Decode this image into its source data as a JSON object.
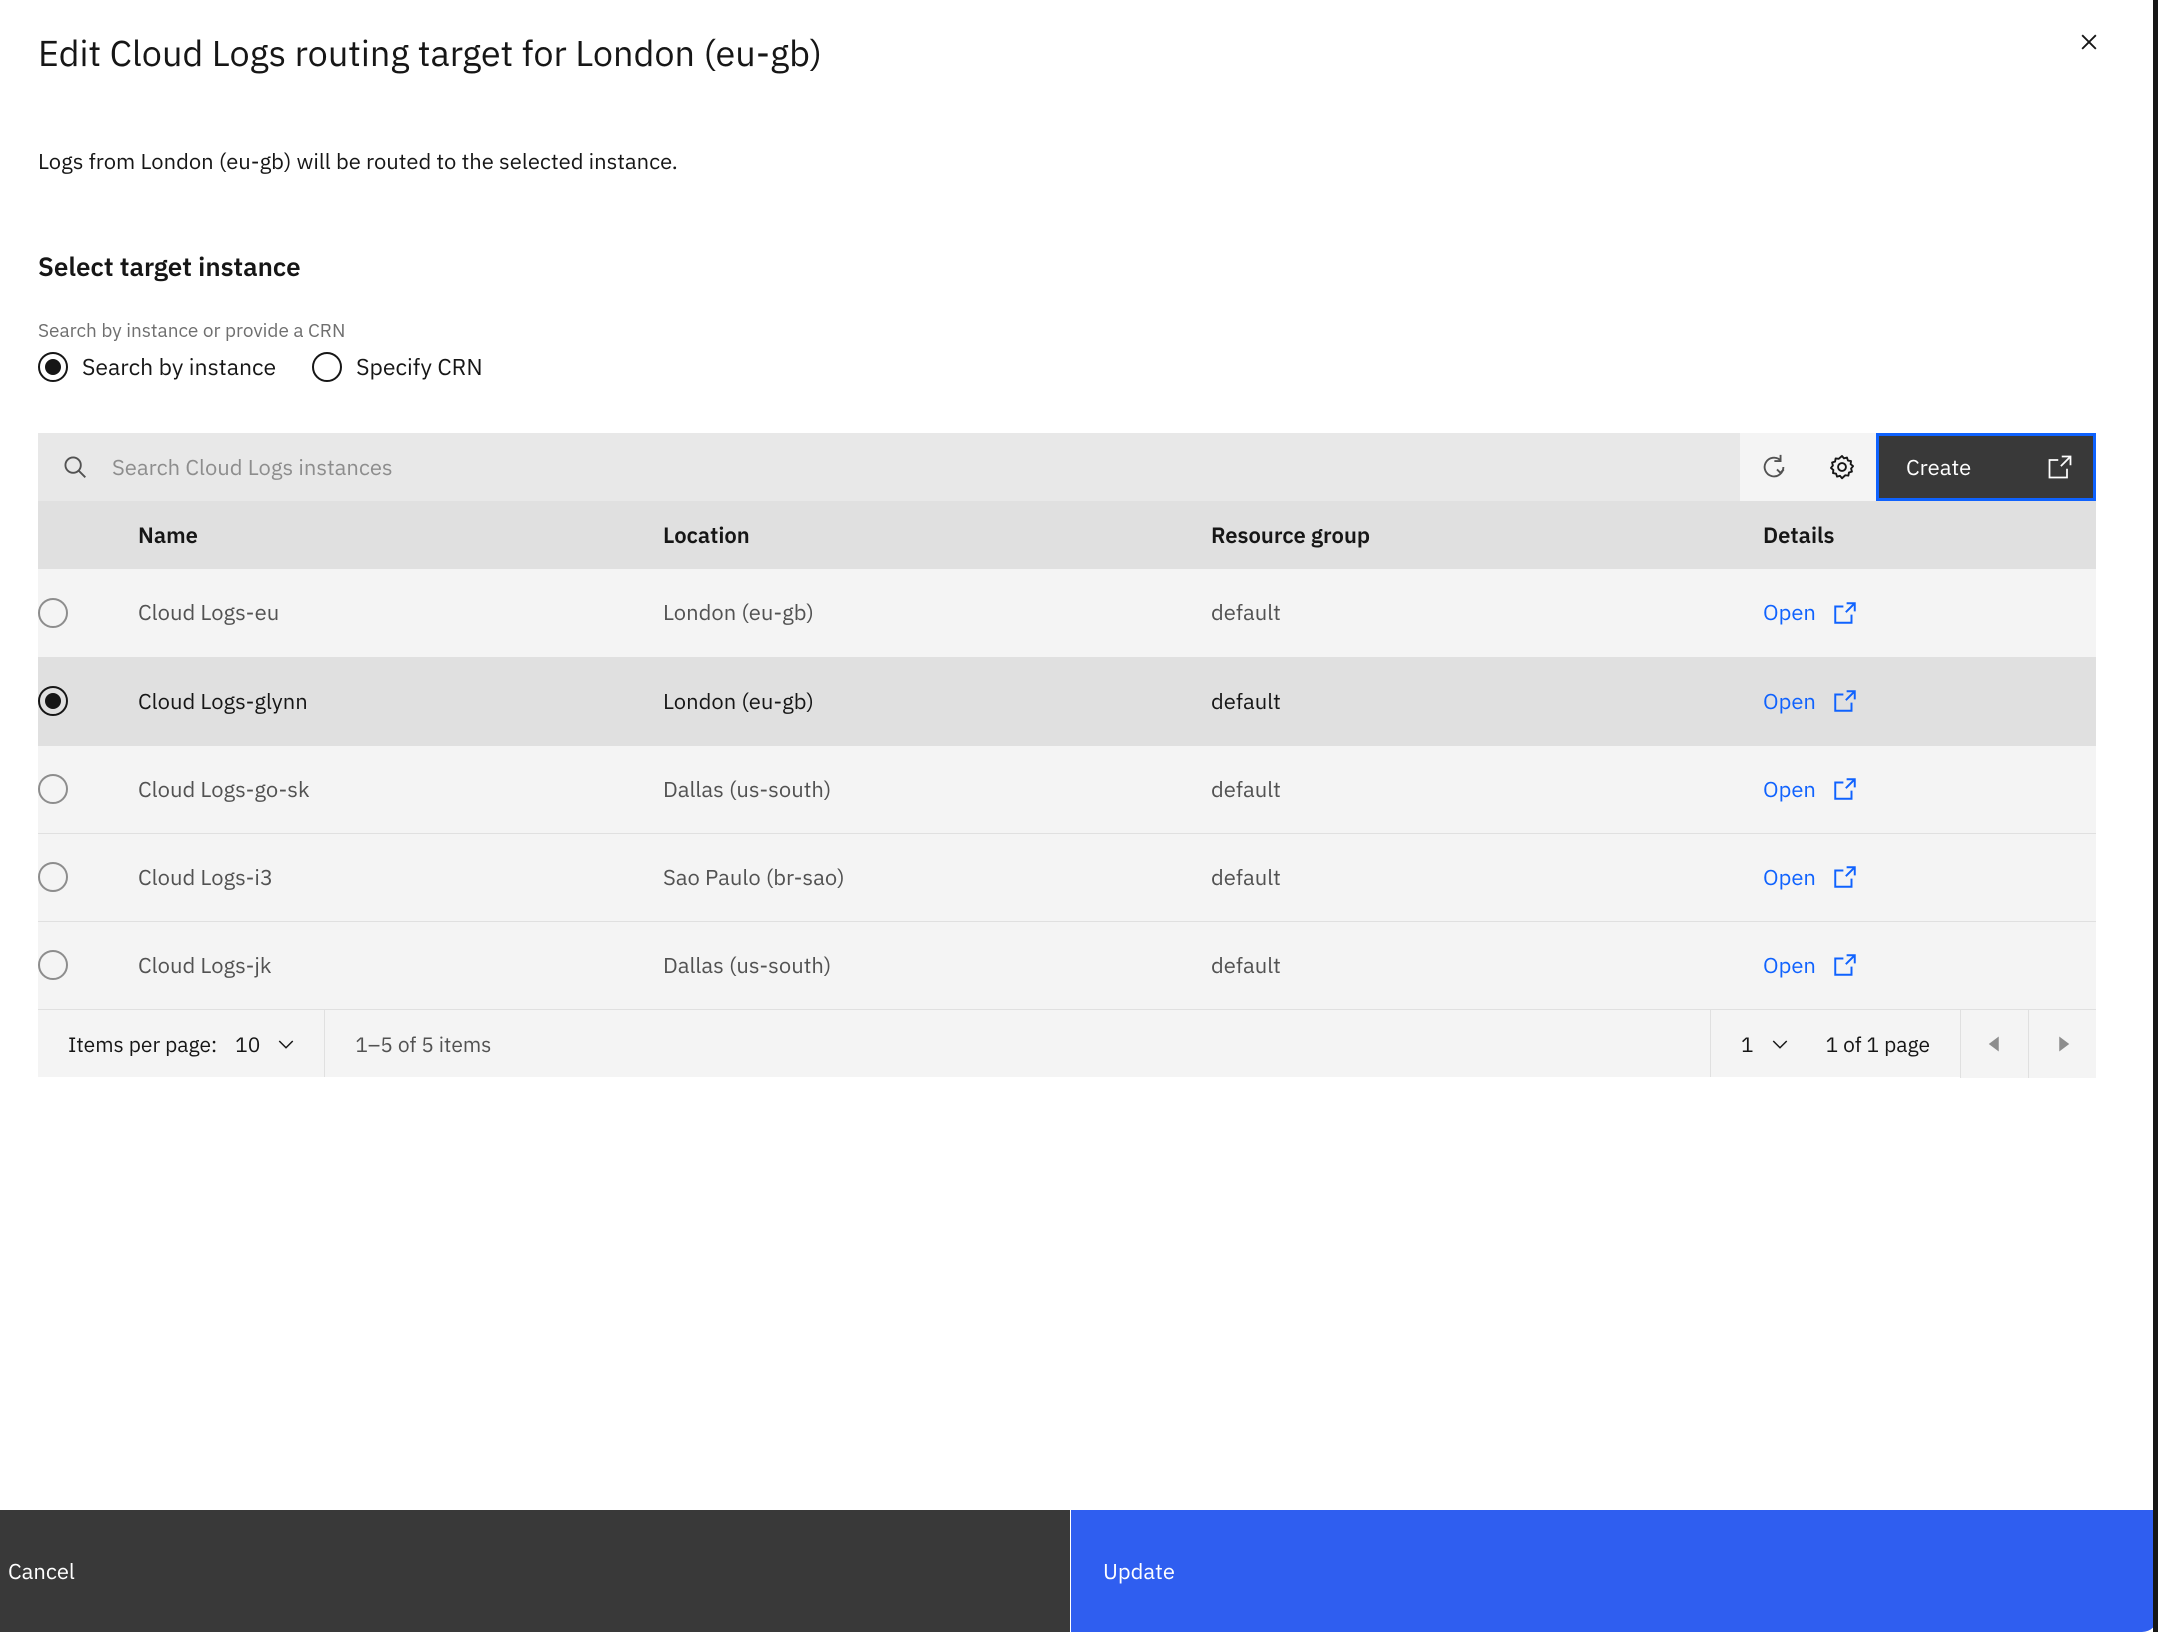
{
  "panel": {
    "title": "Edit Cloud Logs routing target for London (eu-gb)",
    "close_icon": "close-icon",
    "intro": "Logs from London (eu-gb) will be routed to the selected instance.",
    "section_heading": "Select target instance",
    "radio_legend": "Search by instance or provide a CRN"
  },
  "mode_radios": {
    "options": [
      {
        "label": "Search by instance",
        "selected": true
      },
      {
        "label": "Specify CRN",
        "selected": false
      }
    ]
  },
  "toolbar": {
    "search_placeholder": "Search Cloud Logs instances",
    "search_value": "",
    "search_icon": "search-icon",
    "refresh_icon": "refresh-icon",
    "settings_icon": "gear-icon",
    "create_label": "Create",
    "create_icon": "external-link-icon",
    "create_focused": true
  },
  "table": {
    "columns": [
      "",
      "Name",
      "Location",
      "Resource group",
      "Details"
    ],
    "rows": [
      {
        "name": "Cloud Logs-eu",
        "location": "London (eu-gb)",
        "resource_group": "default",
        "details_label": "Open",
        "details_icon": "external-link-icon",
        "selected": false
      },
      {
        "name": "Cloud Logs-glynn",
        "location": "London (eu-gb)",
        "resource_group": "default",
        "details_label": "Open",
        "details_icon": "external-link-icon",
        "selected": true
      },
      {
        "name": "Cloud Logs-go-sk",
        "location": "Dallas (us-south)",
        "resource_group": "default",
        "details_label": "Open",
        "details_icon": "external-link-icon",
        "selected": false
      },
      {
        "name": "Cloud Logs-i3",
        "location": "Sao Paulo (br-sao)",
        "resource_group": "default",
        "details_label": "Open",
        "details_icon": "external-link-icon",
        "selected": false
      },
      {
        "name": "Cloud Logs-jk",
        "location": "Dallas (us-south)",
        "resource_group": "default",
        "details_label": "Open",
        "details_icon": "external-link-icon",
        "selected": false
      }
    ]
  },
  "pagination": {
    "items_per_page_label": "Items per page:",
    "items_per_page_value": "10",
    "range_text": "1–5 of 5 items",
    "page_value": "1",
    "page_total_text": "1 of 1 page",
    "prev_icon": "caret-left-icon",
    "next_icon": "caret-right-icon"
  },
  "actions": {
    "cancel_label": "Cancel",
    "update_label": "Update"
  },
  "colors": {
    "accent_blue": "#0f62fe",
    "primary_button": "#2f5ef0",
    "secondary_button": "#393939",
    "link": "#0f62fe",
    "selected_row": "#e0e0e0",
    "row": "#f4f4f4"
  }
}
